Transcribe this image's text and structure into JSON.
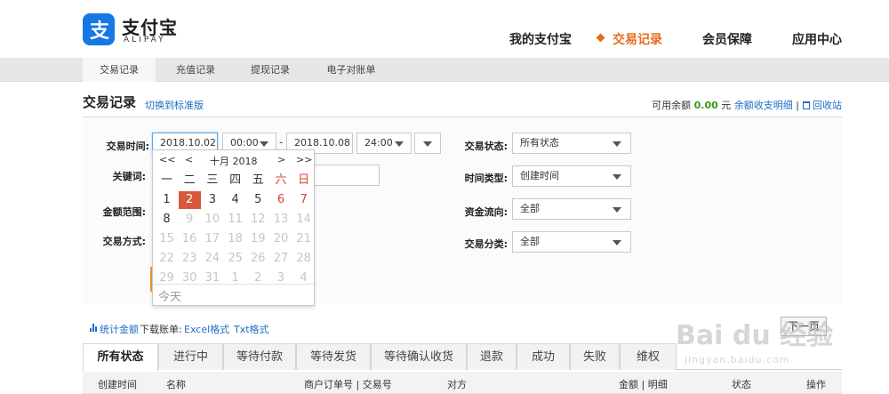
{
  "header": {
    "logo_cn": "支付宝",
    "logo_en": "ALIPAY",
    "nav": [
      "我的支付宝",
      "交易记录",
      "会员保障",
      "应用中心"
    ],
    "active_nav": "交易记录",
    "accent_color": "#e86a1c",
    "brand_color": "#1677e6"
  },
  "subnav": {
    "items": [
      "交易记录",
      "充值记录",
      "提现记录",
      "电子对账单"
    ],
    "active": "交易记录"
  },
  "title_row": {
    "title": "交易记录",
    "switch_link": "切换到标准版",
    "balance_label": "可用余额",
    "balance_amount": "0.00",
    "balance_unit": "元",
    "balance_detail_link": "余额收支明细",
    "separator": "|",
    "trash_icon": "trash-icon",
    "trash_link": "回收站"
  },
  "form": {
    "time_label": "交易时间:",
    "start_date": "2018.10.02",
    "start_time": "00:00",
    "range_sep": "-",
    "end_date": "2018.10.08",
    "end_time": "24:00",
    "keyword_label": "关键词:",
    "keyword_value": "",
    "amount_label": "金额范围:",
    "method_label": "交易方式:",
    "status_label": "交易状态:",
    "status_value": "所有状态",
    "time_type_label": "时间类型:",
    "time_type_value": "创建时间",
    "flow_label": "资金流向:",
    "flow_value": "全部",
    "category_label": "交易分类:",
    "category_value": "全部"
  },
  "calendar": {
    "prev_year": "<<",
    "prev_month": "<",
    "month_title": "十月 2018",
    "next_month": ">",
    "next_year": ">>",
    "weekdays": [
      "一",
      "二",
      "三",
      "四",
      "五",
      "六",
      "日"
    ],
    "weeks": [
      [
        "1",
        "2",
        "3",
        "4",
        "5",
        "6",
        "7"
      ],
      [
        "8",
        "9",
        "10",
        "11",
        "12",
        "13",
        "14"
      ],
      [
        "15",
        "16",
        "17",
        "18",
        "19",
        "20",
        "21"
      ],
      [
        "22",
        "23",
        "24",
        "25",
        "26",
        "27",
        "28"
      ],
      [
        "29",
        "30",
        "31",
        "1",
        "2",
        "3",
        "4"
      ]
    ],
    "selected_day": "2",
    "enabled_range_days": [
      "1",
      "2",
      "3",
      "4",
      "5",
      "6",
      "7",
      "8"
    ],
    "today_label": "今天"
  },
  "toolbar": {
    "stat_icon": "bar-chart-icon",
    "stat_link": "统计金额",
    "download_label": "下载账单:",
    "excel_link": "Excel格式",
    "txt_link": "Txt格式",
    "next_page": "下一页"
  },
  "tabs": [
    "所有状态",
    "进行中",
    "等待付款",
    "等待发货",
    "等待确认收货",
    "退款",
    "成功",
    "失败",
    "维权"
  ],
  "active_tab": "所有状态",
  "table": {
    "headers": [
      "创建时间",
      "名称",
      "商户订单号 | 交易号",
      "对方",
      "金额 | 明细",
      "状态",
      "操作"
    ]
  },
  "watermark": {
    "brand": "Bai du 经验",
    "url": "jingyan.baidu.com"
  }
}
